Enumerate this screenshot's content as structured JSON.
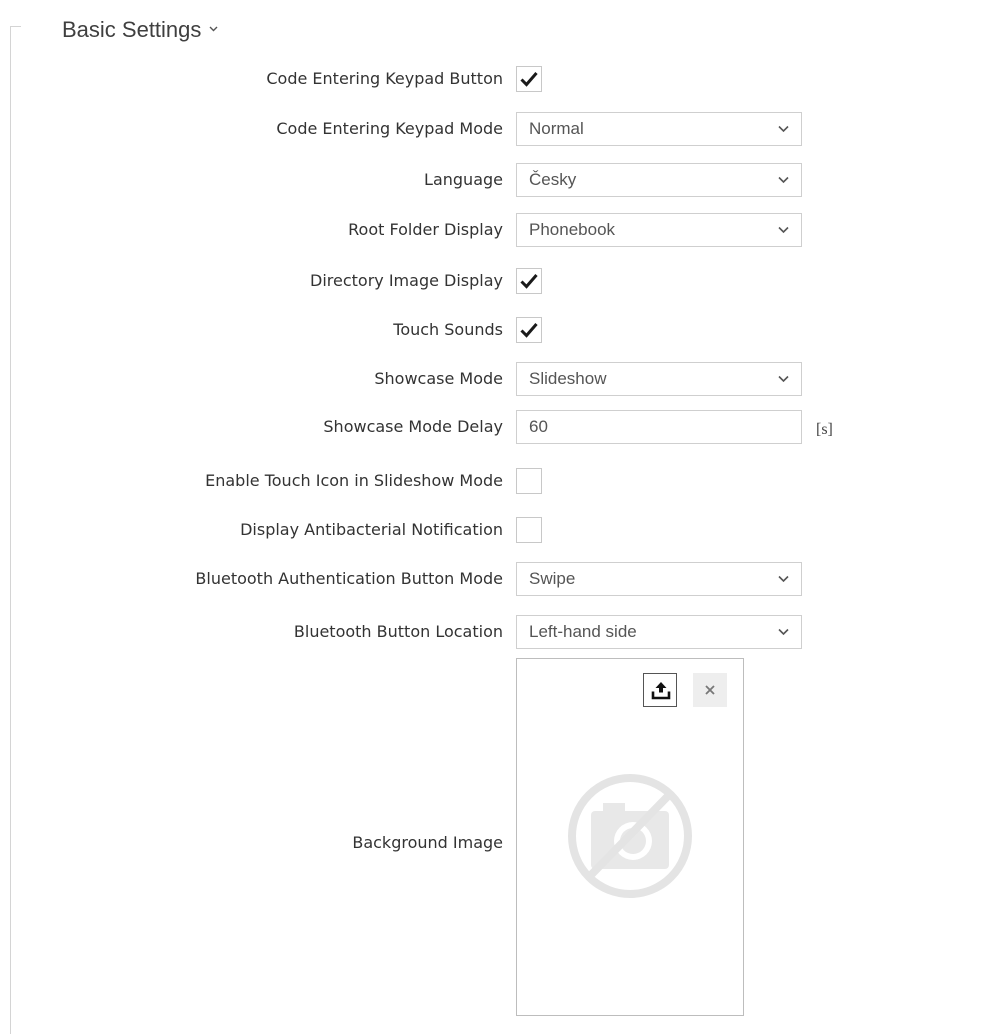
{
  "section": {
    "title": "Basic Settings",
    "expanded": true
  },
  "fields": {
    "code_keypad_button": {
      "label": "Code Entering Keypad Button",
      "checked": true
    },
    "code_keypad_mode": {
      "label": "Code Entering Keypad Mode",
      "value": "Normal"
    },
    "language": {
      "label": "Language",
      "value": "Česky"
    },
    "root_folder_display": {
      "label": "Root Folder Display",
      "value": "Phonebook"
    },
    "directory_image_display": {
      "label": "Directory Image Display",
      "checked": true
    },
    "touch_sounds": {
      "label": "Touch Sounds",
      "checked": true
    },
    "showcase_mode": {
      "label": "Showcase Mode",
      "value": "Slideshow"
    },
    "showcase_mode_delay": {
      "label": "Showcase Mode Delay",
      "value": "60",
      "unit": "[s]"
    },
    "touch_icon_slideshow": {
      "label": "Enable Touch Icon in Slideshow Mode",
      "checked": false
    },
    "antibacterial_notification": {
      "label": "Display Antibacterial Notification",
      "checked": false
    },
    "bt_auth_button_mode": {
      "label": "Bluetooth Authentication Button Mode",
      "value": "Swipe"
    },
    "bt_button_location": {
      "label": "Bluetooth Button Location",
      "value": "Left-hand side"
    },
    "background_image": {
      "label": "Background Image"
    }
  },
  "icons": {
    "upload": "upload-icon",
    "delete": "close-icon",
    "placeholder": "no-photo-icon",
    "select_arrow": "chevron-down-icon",
    "check": "checkmark-icon"
  },
  "colors": {
    "text": "#333333",
    "border": "#cfcfcf",
    "placeholder_icon": "#e4e4e4"
  }
}
